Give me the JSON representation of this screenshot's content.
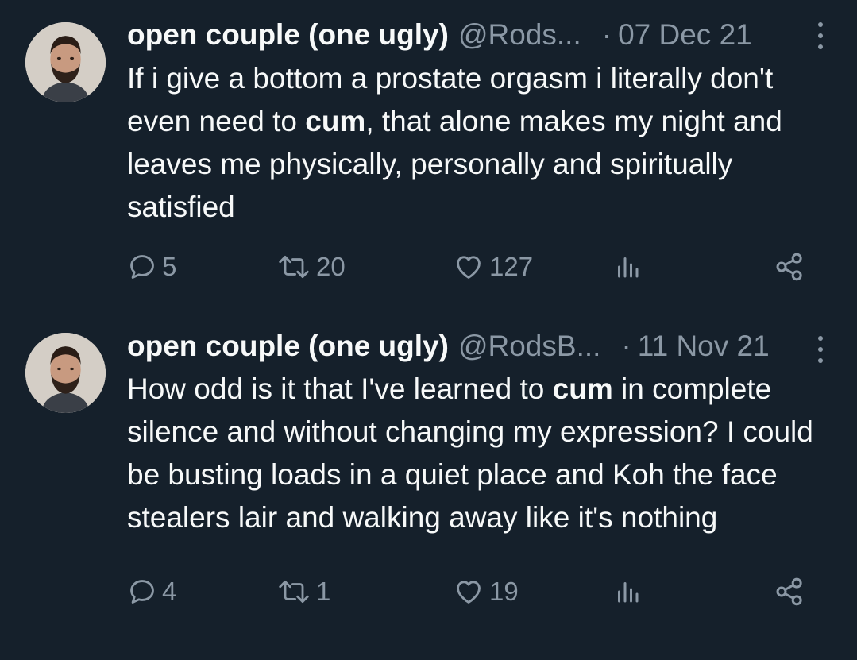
{
  "tweets": [
    {
      "author_name": "open couple (one ugly)",
      "handle": "@Rods...",
      "separator": "·",
      "date": "07 Dec 21",
      "text_parts": [
        "If i give a bottom a prostate orgasm i literally don't even need to ",
        "cum",
        ", that alone makes my night and leaves me physically, personally and spiritually satisfied"
      ],
      "replies": "5",
      "retweets": "20",
      "likes": "127",
      "icons": [
        "reply-icon",
        "retweet-icon",
        "like-icon",
        "views-icon",
        "share-icon",
        "more-icon"
      ]
    },
    {
      "author_name": "open couple (one ugly)",
      "handle": "@RodsB...",
      "separator": "·",
      "date": "11 Nov 21",
      "text_parts": [
        "How odd is it that I've learned to ",
        "cum",
        " in complete silence and without changing my expression? I could be busting loads in a quiet place and Koh the face stealers lair and walking away like it's nothing"
      ],
      "replies": "4",
      "retweets": "1",
      "likes": "19",
      "icons": [
        "reply-icon",
        "retweet-icon",
        "like-icon",
        "views-icon",
        "share-icon",
        "more-icon"
      ]
    }
  ],
  "colors": {
    "background": "#15202b",
    "text": "#f7f9f9",
    "secondary": "#8b98a5",
    "divider": "#38444d"
  }
}
